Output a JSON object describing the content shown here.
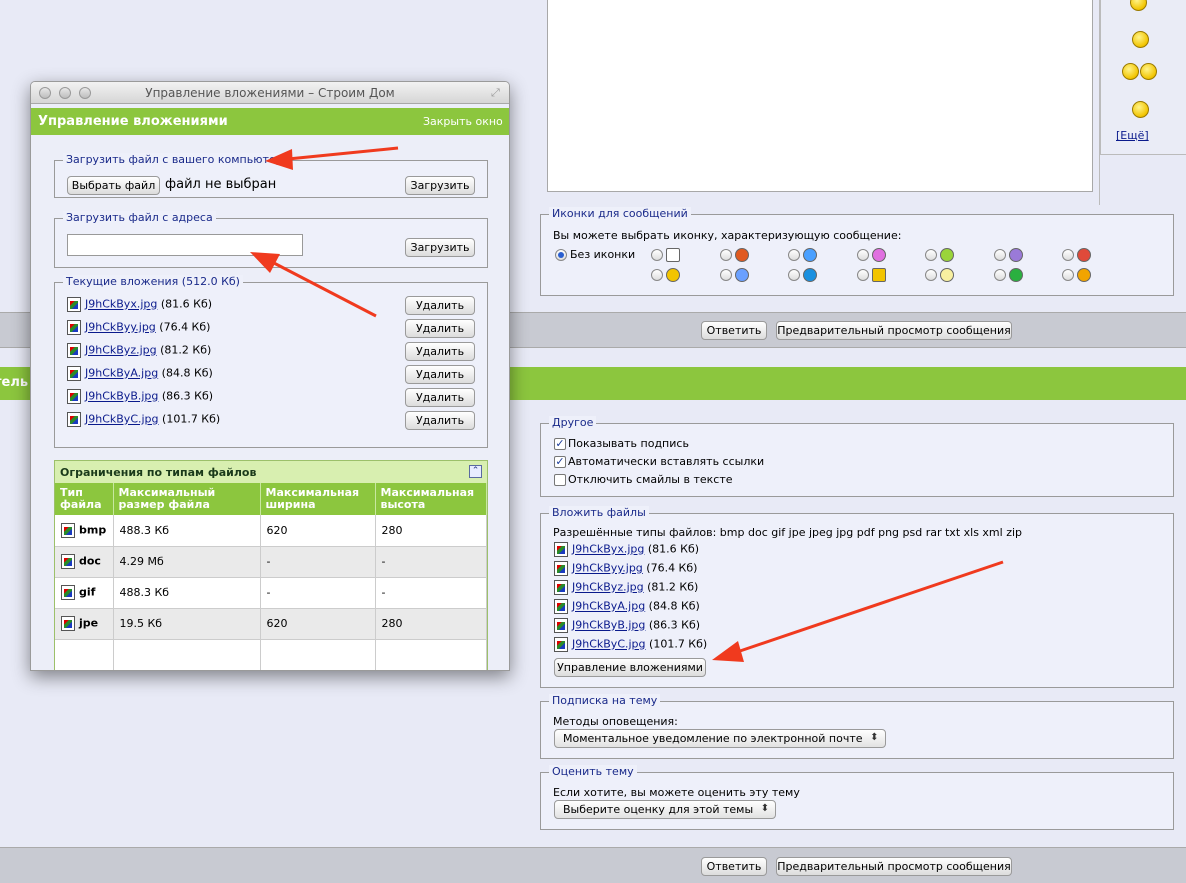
{
  "textarea_panel": {},
  "smilies": {
    "more_link": "[Ещё]"
  },
  "icons_section": {
    "legend": "Иконки для сообщений",
    "description": "Вы можете выбрать иконку, характеризующую сообщение:",
    "no_icon_label": "Без иконки"
  },
  "reply_bar_top": {
    "reply_label": "Ответить",
    "preview_label": "Предварительный просмотр сообщения"
  },
  "green_band": {
    "partial_text": "тель"
  },
  "other_section": {
    "legend": "Другое",
    "options": [
      {
        "label": "Показывать подпись",
        "checked": true
      },
      {
        "label": "Автоматически вставлять ссылки",
        "checked": true
      },
      {
        "label": "Отключить смайлы в тексте",
        "checked": false
      }
    ]
  },
  "attach_section": {
    "legend": "Вложить файлы",
    "allowed_types": "Разрешённые типы файлов: bmp doc gif jpe jpeg jpg pdf png psd rar txt xls xml zip",
    "files": [
      {
        "name": "J9hCkByx.jpg",
        "size": "(81.6 Кб)"
      },
      {
        "name": "J9hCkByy.jpg",
        "size": "(76.4 Кб)"
      },
      {
        "name": "J9hCkByz.jpg",
        "size": "(81.2 Кб)"
      },
      {
        "name": "J9hCkByA.jpg",
        "size": "(84.8 Кб)"
      },
      {
        "name": "J9hCkByB.jpg",
        "size": "(86.3 Кб)"
      },
      {
        "name": "J9hCkByC.jpg",
        "size": "(101.7 Кб)"
      }
    ],
    "manage_label": "Управление вложениями"
  },
  "subscribe_section": {
    "legend": "Подписка на тему",
    "label": "Методы оповещения:",
    "selected": "Моментальное уведомление по электронной почте"
  },
  "rate_section": {
    "legend": "Оценить тему",
    "label": "Если хотите, вы можете оценить эту тему",
    "selected": "Выберите оценку для этой темы"
  },
  "reply_bar_bottom": {
    "reply_label": "Ответить",
    "preview_label": "Предварительный просмотр сообщения"
  },
  "popup": {
    "window_title": "Управление вложениями – Строим Дом",
    "header_title": "Управление вложениями",
    "close_link": "Закрыть окно",
    "upload_local": {
      "legend": "Загрузить файл с вашего компьютера",
      "choose_label": "Выбрать файл",
      "no_file_text": "файл не выбран",
      "upload_label": "Загрузить"
    },
    "upload_url": {
      "legend": "Загрузить файл с адреса",
      "value": "",
      "upload_label": "Загрузить"
    },
    "current": {
      "legend": "Текущие вложения (512.0 Кб)",
      "delete_label": "Удалить",
      "files": [
        {
          "name": "J9hCkByx.jpg",
          "size": "(81.6 Кб)"
        },
        {
          "name": "J9hCkByy.jpg",
          "size": "(76.4 Кб)"
        },
        {
          "name": "J9hCkByz.jpg",
          "size": "(81.2 Кб)"
        },
        {
          "name": "J9hCkByA.jpg",
          "size": "(84.8 Кб)"
        },
        {
          "name": "J9hCkByB.jpg",
          "size": "(86.3 Кб)"
        },
        {
          "name": "J9hCkByC.jpg",
          "size": "(101.7 Кб)"
        }
      ]
    },
    "limits": {
      "title": "Ограничения по типам файлов",
      "headers": [
        "Тип файла",
        "Максимальный размер файла",
        "Максимальная ширина",
        "Максимальная высота"
      ],
      "rows": [
        {
          "type": "bmp",
          "size": "488.3 Кб",
          "width": "620",
          "height": "280"
        },
        {
          "type": "doc",
          "size": "4.29 Мб",
          "width": "-",
          "height": "-"
        },
        {
          "type": "gif",
          "size": "488.3 Кб",
          "width": "-",
          "height": "-"
        },
        {
          "type": "jpe",
          "size": "19.5 Кб",
          "width": "620",
          "height": "280"
        }
      ]
    }
  },
  "colors": {
    "accent_green": "#8cc63e",
    "annotation_arrow": "#f03a1e",
    "page_bg": "#e8eaf6"
  }
}
